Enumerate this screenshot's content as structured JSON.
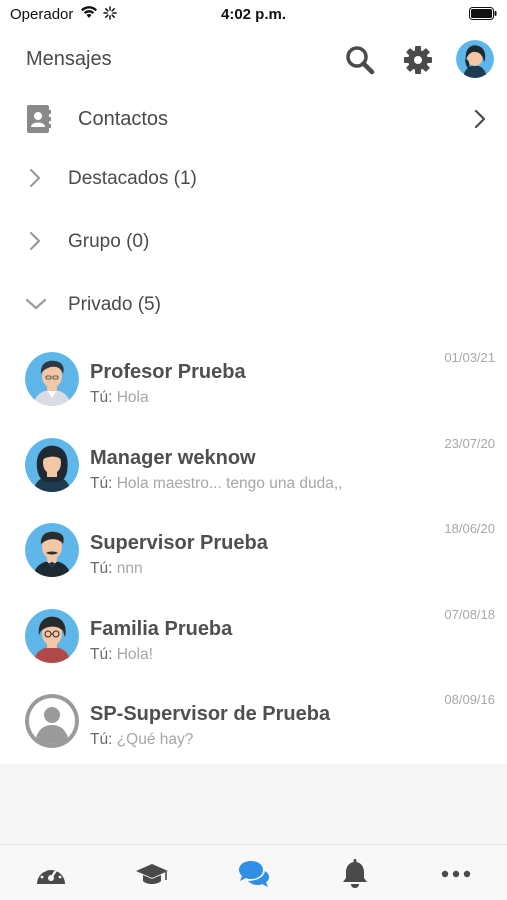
{
  "status_bar": {
    "carrier": "Operador",
    "time": "4:02 p.m."
  },
  "header": {
    "title": "Mensajes"
  },
  "contacts": {
    "label": "Contactos"
  },
  "sections": [
    {
      "label": "Destacados (1)",
      "expanded": false
    },
    {
      "label": "Grupo (0)",
      "expanded": false
    },
    {
      "label": "Privado (5)",
      "expanded": true
    }
  ],
  "conversations": [
    {
      "name": "Profesor Prueba",
      "prefix": "Tú:",
      "text": "Hola",
      "date": "01/03/21",
      "avatar": "teacher-avatar"
    },
    {
      "name": "Manager weknow",
      "prefix": "Tú:",
      "text": "Hola maestro... tengo una duda,,",
      "date": "23/07/20",
      "avatar": "woman-avatar"
    },
    {
      "name": "Supervisor Prueba",
      "prefix": "Tú:",
      "text": "nnn",
      "date": "18/06/20",
      "avatar": "mustache-man-avatar"
    },
    {
      "name": "Familia Prueba",
      "prefix": "Tú:",
      "text": "Hola!",
      "date": "07/08/18",
      "avatar": "glasses-woman-avatar"
    },
    {
      "name": "SP-Supervisor de Prueba",
      "prefix": "Tú:",
      "text": "¿Qué hay?",
      "date": "08/09/16",
      "avatar": "default-user-avatar"
    }
  ],
  "tab_bar": {
    "tabs": [
      "dashboard-icon",
      "graduation-cap-icon",
      "chat-bubbles-icon",
      "bell-icon",
      "more-icon"
    ],
    "active": "chat-bubbles-icon",
    "active_color": "#2f8fe6",
    "inactive_color": "#4a4a4a"
  }
}
